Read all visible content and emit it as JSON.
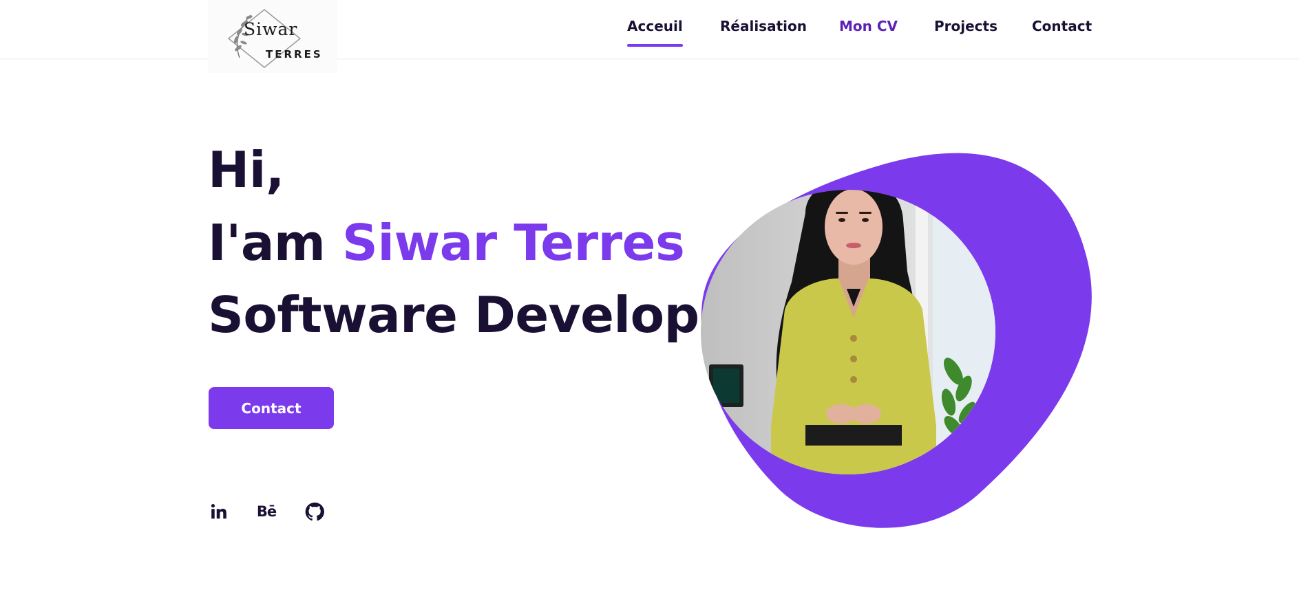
{
  "header": {
    "logo": {
      "line1": "Siwar",
      "line2": "TERRES",
      "icon": "leaf-diamond-logo"
    },
    "nav": [
      {
        "label": "Acceuil",
        "active": true
      },
      {
        "label": "Réalisation",
        "active": false
      },
      {
        "label": "Mon CV",
        "active": false,
        "highlight": true
      },
      {
        "label": "Projects",
        "active": false
      },
      {
        "label": "Contact",
        "active": false
      }
    ]
  },
  "hero": {
    "greeting": "Hi,",
    "intro_prefix": "I'am",
    "name": "Siwar Terres",
    "role": "Software Developer",
    "cta_label": "Contact"
  },
  "social": [
    {
      "icon": "linkedin-icon",
      "label": "in"
    },
    {
      "icon": "behance-icon",
      "label": "Bē"
    },
    {
      "icon": "github-icon",
      "label": ""
    }
  ],
  "colors": {
    "accent": "#7c3aed",
    "text": "#1a1033",
    "nav_highlight": "#5b21b6"
  }
}
